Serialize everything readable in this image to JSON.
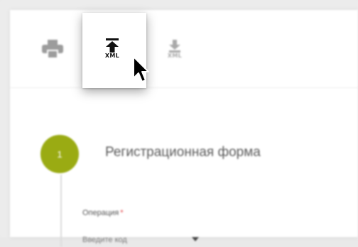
{
  "toolbar": {
    "print_icon": "printer-icon",
    "upload_icon": "upload-xml-icon",
    "download_icon": "download-xml-icon",
    "upload_label": "XML",
    "download_label": "XML"
  },
  "form": {
    "step_number": "1",
    "step_title": "Регистрационная форма",
    "field_label": "Операция",
    "required_mark": "*",
    "select_value": "Введите код"
  },
  "colors": {
    "accent": "#9aab13",
    "required": "#e0393e"
  }
}
